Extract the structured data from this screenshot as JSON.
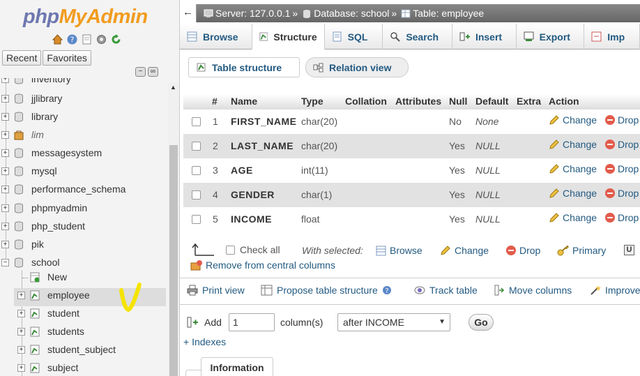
{
  "logo": {
    "php": "php",
    "myadmin": "MyAdmin"
  },
  "nav": {
    "recent": "Recent",
    "favorites": "Favorites",
    "icons": [
      "home-icon",
      "info-icon",
      "docs-icon",
      "settings-icon",
      "reload-icon"
    ],
    "tree": [
      {
        "label": "inventory",
        "type": "db"
      },
      {
        "label": "jjlibrary",
        "type": "db"
      },
      {
        "label": "library",
        "type": "db"
      },
      {
        "label": "lim",
        "type": "db-italic"
      },
      {
        "label": "messagesystem",
        "type": "db"
      },
      {
        "label": "mysql",
        "type": "db"
      },
      {
        "label": "performance_schema",
        "type": "db"
      },
      {
        "label": "phpmyadmin",
        "type": "db"
      },
      {
        "label": "php_student",
        "type": "db"
      },
      {
        "label": "pik",
        "type": "db"
      },
      {
        "label": "school",
        "type": "db-open"
      },
      {
        "label": "New",
        "type": "new"
      },
      {
        "label": "employee",
        "type": "table",
        "active": true
      },
      {
        "label": "student",
        "type": "table"
      },
      {
        "label": "students",
        "type": "table"
      },
      {
        "label": "student_subject",
        "type": "table"
      },
      {
        "label": "subject",
        "type": "table"
      }
    ]
  },
  "breadcrumb": {
    "back": "←",
    "server": "Server: 127.0.0.1",
    "database": "Database: school",
    "table": "Table: employee",
    "sep": "»"
  },
  "topmenu": [
    {
      "label": "Browse",
      "icon": "browse-icon"
    },
    {
      "label": "Structure",
      "icon": "structure-icon",
      "active": true
    },
    {
      "label": "SQL",
      "icon": "sql-icon"
    },
    {
      "label": "Search",
      "icon": "search-icon"
    },
    {
      "label": "Insert",
      "icon": "insert-icon"
    },
    {
      "label": "Export",
      "icon": "export-icon"
    },
    {
      "label": "Imp",
      "icon": "import-icon"
    }
  ],
  "subtabs": {
    "table_structure": "Table structure",
    "relation_view": "Relation view"
  },
  "table": {
    "headers": [
      "#",
      "Name",
      "Type",
      "Collation",
      "Attributes",
      "Null",
      "Default",
      "Extra",
      "Action"
    ],
    "rows": [
      {
        "num": "1",
        "name": "FIRST_NAME",
        "type": "char(20)",
        "null": "No",
        "default": "None"
      },
      {
        "num": "2",
        "name": "LAST_NAME",
        "type": "char(20)",
        "null": "Yes",
        "default": "NULL"
      },
      {
        "num": "3",
        "name": "AGE",
        "type": "int(11)",
        "null": "Yes",
        "default": "NULL"
      },
      {
        "num": "4",
        "name": "GENDER",
        "type": "char(1)",
        "null": "Yes",
        "default": "NULL"
      },
      {
        "num": "5",
        "name": "INCOME",
        "type": "float",
        "null": "Yes",
        "default": "NULL"
      }
    ],
    "change": "Change",
    "drop": "Drop"
  },
  "with_selected": {
    "check_all": "Check all",
    "label": "With selected:",
    "browse": "Browse",
    "change": "Change",
    "drop": "Drop",
    "primary": "Primary",
    "unique": "U",
    "remove_central": "Remove from central columns"
  },
  "tools": {
    "print": "Print view",
    "propose": "Propose table structure",
    "track": "Track table",
    "move": "Move columns",
    "improve": "Improve"
  },
  "add_columns": {
    "add": "Add",
    "count": "1",
    "columns": "column(s)",
    "position": "after INCOME",
    "go": "Go"
  },
  "indexes": "+ Indexes",
  "information": "Information"
}
